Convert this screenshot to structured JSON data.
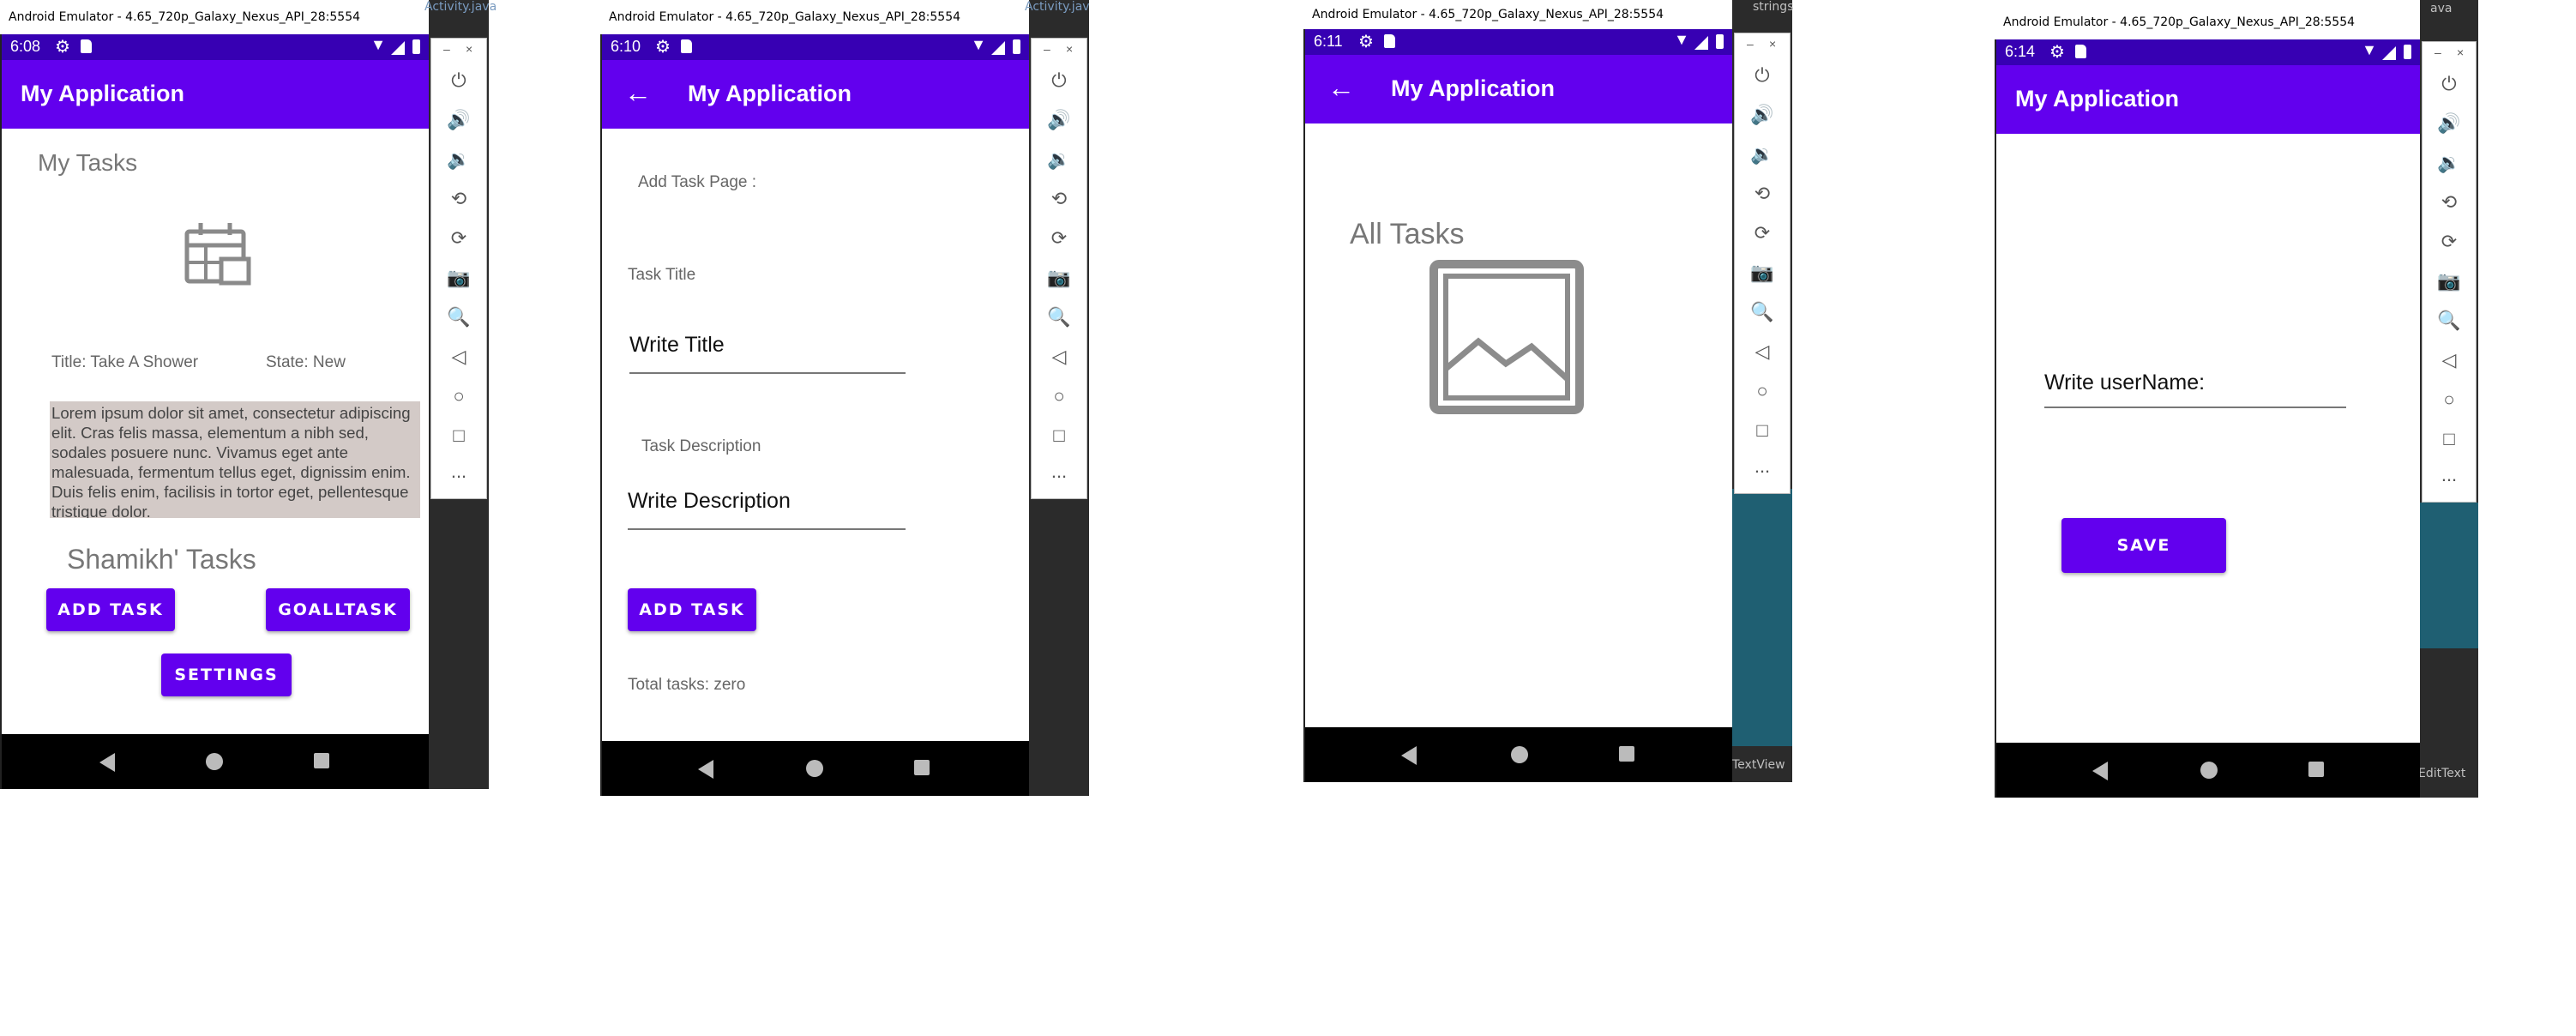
{
  "emulator_title": "Android Emulator - 4.65_720p_Galaxy_Nexus_API_28:5554",
  "panel_ellipsis": "...",
  "screen1": {
    "bg_text": "Activity.java",
    "time": "6:08",
    "app_title": "My Application",
    "heading": "My Tasks",
    "task_title": "Title: Take A Shower",
    "task_state": "State: New",
    "lorem": "Lorem ipsum dolor sit amet, consectetur adipiscing elit. Cras felis massa, elementum a nibh sed, sodales posuere nunc. Vivamus eget ante malesuada, fermentum tellus eget, dignissim enim. Duis felis enim, facilisis in tortor eget, pellentesque tristique dolor.",
    "user_tasks": "Shamikh' Tasks",
    "add_task_button": "ADD TASK",
    "goall_button": "GOALLTASK",
    "settings_button": "SETTINGS"
  },
  "screen2": {
    "bg_text": "Activity.jav",
    "time": "6:10",
    "app_title": "My Application",
    "page_label": "Add Task Page :",
    "title_label": "Task Title",
    "title_placeholder": "Write Title",
    "desc_label": "Task Description",
    "desc_placeholder": "Write Description",
    "add_task_button": "ADD TASK",
    "total_tasks": "Total tasks: zero"
  },
  "screen3": {
    "bg_text_top": "strings",
    "bg_text_bottom": "TextView",
    "time": "6:11",
    "app_title": "My Application",
    "heading": "All Tasks"
  },
  "screen4": {
    "bg_text_top": "ava",
    "bg_text_bottom": "EditText",
    "time": "6:14",
    "app_title": "My Application",
    "username_placeholder": "Write userName:",
    "save_button": "SAVE"
  },
  "colors": {
    "status": "#3700b3",
    "appbar": "#6200ee",
    "accent": "#6200ee",
    "lorem_bg": "#d3cac7"
  },
  "icons": [
    "gear-icon",
    "sd-card-icon",
    "wifi-icon",
    "signal-icon",
    "battery-icon",
    "back-arrow-icon",
    "calendar-icon",
    "image-placeholder-icon",
    "power-icon",
    "volume-up-icon",
    "volume-down-icon",
    "rotate-left-icon",
    "rotate-right-icon",
    "camera-icon",
    "zoom-icon",
    "back-icon",
    "home-icon",
    "overview-icon",
    "more-icon"
  ]
}
